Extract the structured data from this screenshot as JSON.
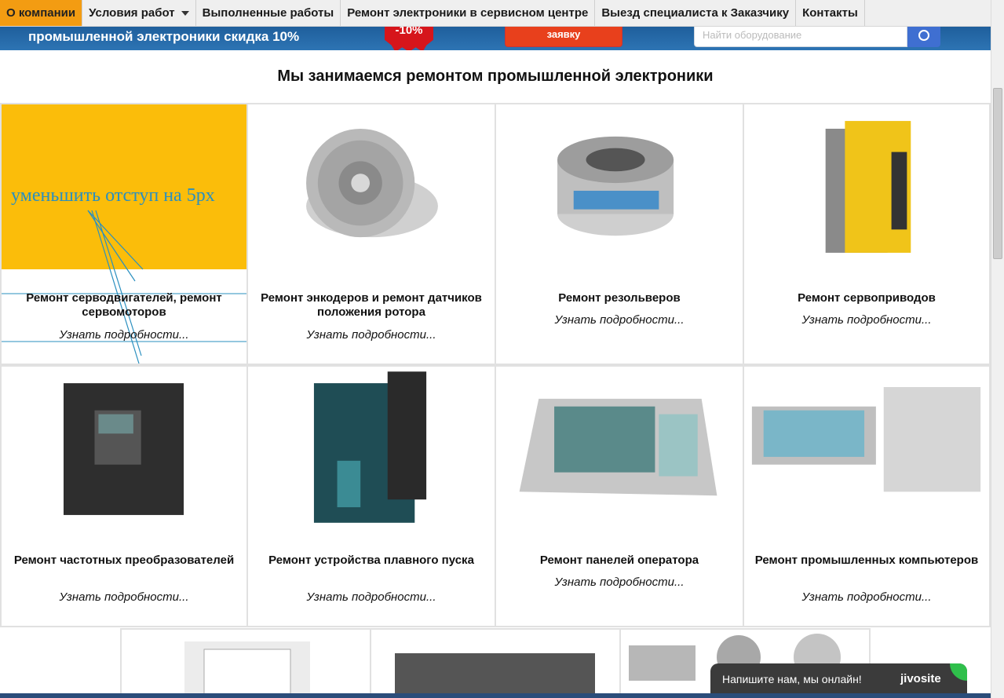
{
  "nav": {
    "items": [
      {
        "label": "О компании",
        "active": true
      },
      {
        "label": "Условия работ",
        "dropdown": true
      },
      {
        "label": "Выполненные работы"
      },
      {
        "label": "Ремонт электроники в сервисном центре"
      },
      {
        "label": "Выезд специалиста к Заказчику"
      },
      {
        "label": "Контакты"
      }
    ]
  },
  "banner": {
    "text": "промышленной электроники скидка 10%",
    "badge": "-10%",
    "cta": "заявку",
    "search_placeholder": "Найти оборудование"
  },
  "heading": "Мы занимаемся ремонтом промышленной электроники",
  "annotation": "уменьшить отступ на 5px",
  "more_label": "Узнать подробности...",
  "cards": [
    {
      "title": "Ремонт серводвигателей, ремонт сервомоторов",
      "image": "yellow-placeholder"
    },
    {
      "title": "Ремонт энкодеров и ремонт датчиков положения ротора",
      "image": "encoder-photo"
    },
    {
      "title": "Ремонт резольверов",
      "image": "resolver-photo"
    },
    {
      "title": "Ремонт сервоприводов",
      "image": "servo-drive-photo"
    },
    {
      "title": "Ремонт частотных преобразователей",
      "image": "frequency-inverter-photo"
    },
    {
      "title": "Ремонт устройства плавного пуска",
      "image": "soft-starter-photo"
    },
    {
      "title": "Ремонт панелей оператора",
      "image": "operator-panel-photo"
    },
    {
      "title": "Ремонт промышленных компьютеров",
      "image": "industrial-pc-photo"
    }
  ],
  "chat": {
    "text": "Напишите нам, мы онлайн!",
    "brand": "jivosite",
    "accent": "#2fbf4b"
  },
  "colors": {
    "nav_active": "#f39c12",
    "banner": "#2d74b4",
    "placeholder_yellow": "#fbbd0a",
    "annotation": "#2a8fbf"
  }
}
